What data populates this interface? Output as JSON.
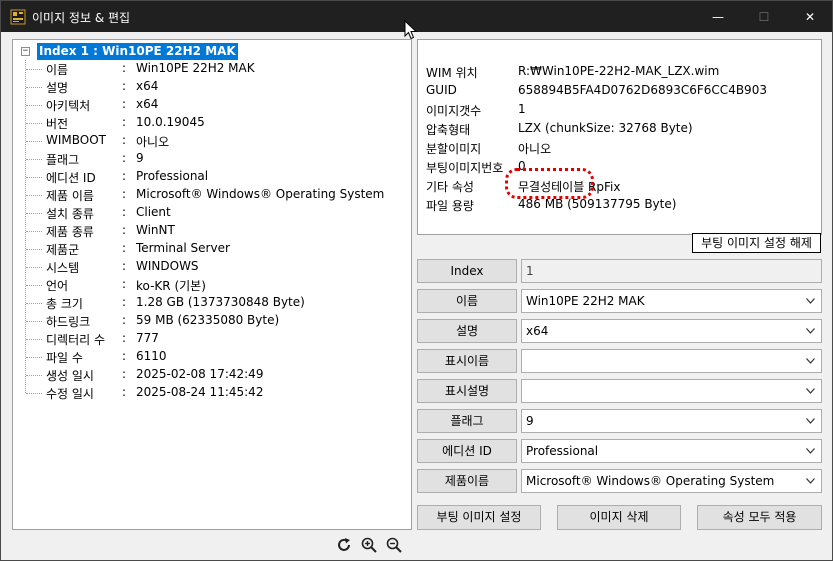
{
  "window": {
    "title": "이미지 정보 & 편집",
    "minimize_glyph": "—",
    "maximize_glyph": "☐",
    "close_glyph": "✕"
  },
  "tree": {
    "root_label": "Index 1 : Win10PE 22H2 MAK",
    "separator": ":",
    "items": [
      {
        "key": "이름",
        "value": "Win10PE 22H2 MAK"
      },
      {
        "key": "설명",
        "value": "x64"
      },
      {
        "key": "아키텍처",
        "value": "x64"
      },
      {
        "key": "버전",
        "value": "10.0.19045"
      },
      {
        "key": "WIMBOOT",
        "value": "아니오"
      },
      {
        "key": "플래그",
        "value": "9"
      },
      {
        "key": "에디션 ID",
        "value": "Professional"
      },
      {
        "key": "제품 이름",
        "value": "Microsoft® Windows® Operating System"
      },
      {
        "key": "설치 종류",
        "value": "Client"
      },
      {
        "key": "제품 종류",
        "value": "WinNT"
      },
      {
        "key": "제품군",
        "value": "Terminal Server"
      },
      {
        "key": "시스템",
        "value": "WINDOWS"
      },
      {
        "key": "언어",
        "value": "ko-KR (기본)"
      },
      {
        "key": "총 크기",
        "value": "1.28 GB  (1373730848 Byte)"
      },
      {
        "key": "하드링크",
        "value": "59 MB  (62335080 Byte)"
      },
      {
        "key": "디렉터리 수",
        "value": "777"
      },
      {
        "key": "파일 수",
        "value": "6110"
      },
      {
        "key": "생성 일시",
        "value": "2025-02-08 17:42:49"
      },
      {
        "key": "수정 일시",
        "value": "2025-08-24 11:45:42"
      }
    ]
  },
  "toolbar_icons": [
    "refresh-icon",
    "zoom-in-icon",
    "zoom-out-icon"
  ],
  "info": {
    "rows": [
      {
        "key": "WIM 위치",
        "value": "R:₩Win10PE-22H2-MAK_LZX.wim"
      },
      {
        "key": "GUID",
        "value": "658894B5FA4D0762D6893C6F6CC4B903"
      },
      {
        "key": "이미지갯수",
        "value": "1"
      },
      {
        "key": "압축형태",
        "value": "LZX  (chunkSize: 32768 Byte)"
      },
      {
        "key": "분할이미지",
        "value": "아니오"
      },
      {
        "key": "부팅이미지번호",
        "value": "0"
      },
      {
        "key": "기타 속성",
        "value": "무결성테이블 RpFix"
      },
      {
        "key": "파일 용량",
        "value": "486 MB  (509137795 Byte)"
      }
    ],
    "highlight_color": "#e00000"
  },
  "unset_boot_button": "부팅 이미지 설정 해제",
  "properties": [
    {
      "label": "Index",
      "value": "1",
      "readonly": true
    },
    {
      "label": "이름",
      "value": "Win10PE 22H2 MAK",
      "readonly": false
    },
    {
      "label": "설명",
      "value": "x64",
      "readonly": false
    },
    {
      "label": "표시이름",
      "value": "",
      "readonly": false
    },
    {
      "label": "표시설명",
      "value": "",
      "readonly": false
    },
    {
      "label": "플래그",
      "value": "9",
      "readonly": false
    },
    {
      "label": "에디션 ID",
      "value": "Professional",
      "readonly": false
    },
    {
      "label": "제품이름",
      "value": "Microsoft® Windows® Operating System",
      "readonly": false
    }
  ],
  "bottom_buttons": {
    "set_boot": "부팅 이미지 설정",
    "delete": "이미지 삭제",
    "apply_all": "속성 모두 적용"
  },
  "colors": {
    "titlebar": "#202020",
    "selection": "#0078d7",
    "button_face": "#e1e1e1"
  }
}
